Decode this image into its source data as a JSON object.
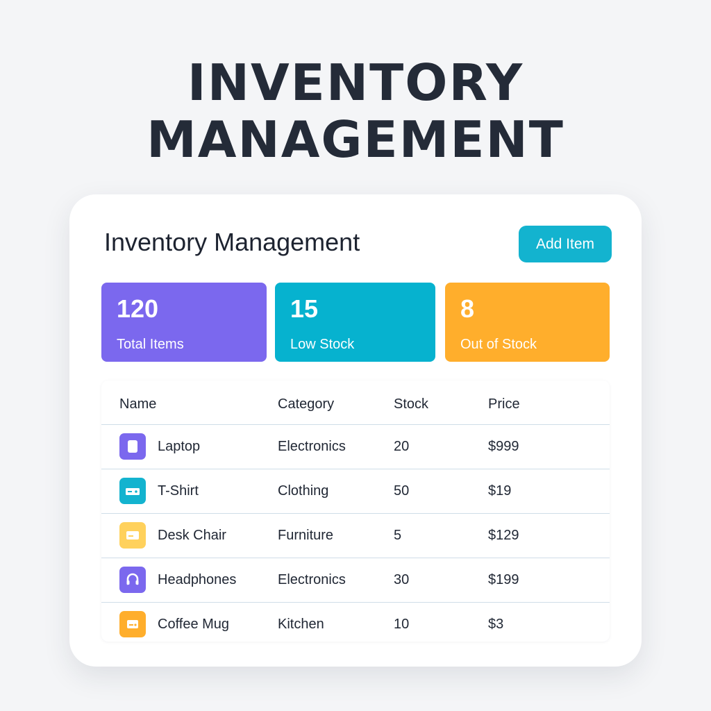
{
  "hero": {
    "line1": "INVENTORY",
    "line2": "MANAGEMENT"
  },
  "card": {
    "title": "Inventory Management",
    "add_button_label": "Add Item"
  },
  "stats": [
    {
      "value": "120",
      "label": "Total Items",
      "color": "#7b68ee"
    },
    {
      "value": "15",
      "label": "Low Stock",
      "color": "#06b2cf"
    },
    {
      "value": "8",
      "label": "Out of Stock",
      "color": "#ffae2c"
    }
  ],
  "table": {
    "headers": {
      "name": "Name",
      "category": "Category",
      "stock": "Stock",
      "price": "Price"
    },
    "rows": [
      {
        "icon": "laptop-icon",
        "icon_color": "#7b68ee",
        "name": "Laptop",
        "category": "Electronics",
        "stock": "20",
        "price": "$999"
      },
      {
        "icon": "tshirt-icon",
        "icon_color": "#13b3cf",
        "name": "T-Shirt",
        "category": "Clothing",
        "stock": "50",
        "price": "$19"
      },
      {
        "icon": "chair-icon",
        "icon_color": "#ffd15c",
        "name": "Desk Chair",
        "category": "Furniture",
        "stock": "5",
        "price": "$129"
      },
      {
        "icon": "headphones-icon",
        "icon_color": "#7b68ee",
        "name": "Headphones",
        "category": "Electronics",
        "stock": "30",
        "price": "$199"
      },
      {
        "icon": "mug-icon",
        "icon_color": "#ffae2c",
        "name": "Coffee Mug",
        "category": "Kitchen",
        "stock": "10",
        "price": "$3"
      }
    ]
  }
}
